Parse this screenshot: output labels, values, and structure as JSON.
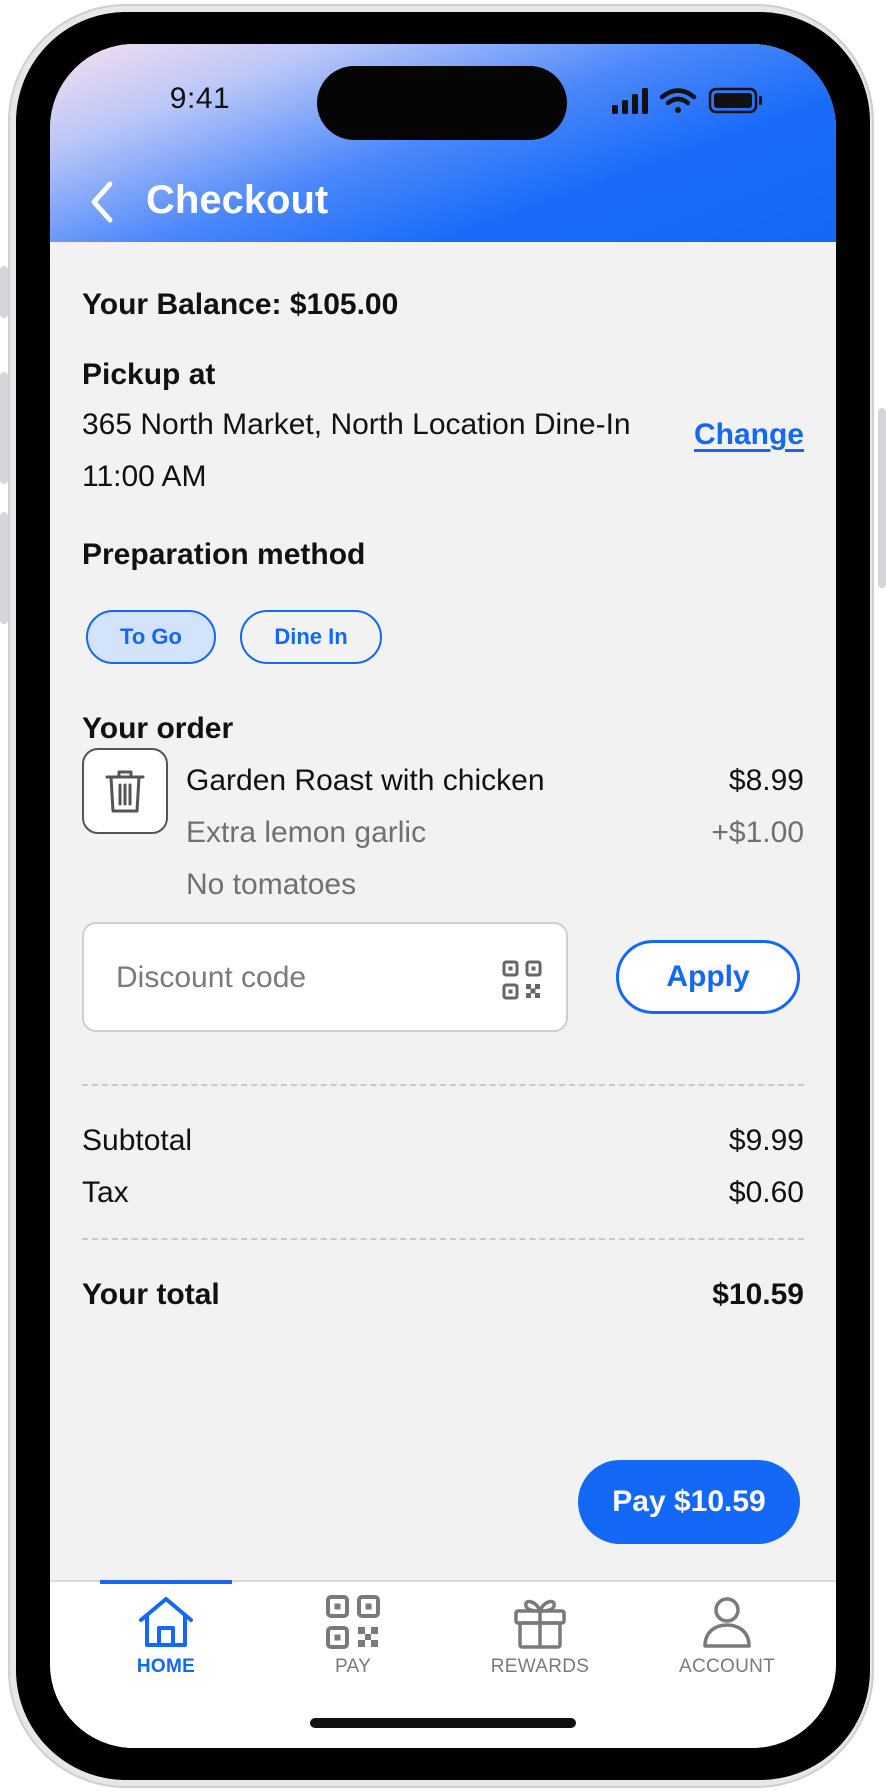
{
  "status_bar": {
    "time": "9:41"
  },
  "header": {
    "title": "Checkout"
  },
  "balance": {
    "text": "Your Balance: $105.00"
  },
  "pickup": {
    "heading": "Pickup at",
    "location": "365 North Market, North Location Dine-In",
    "time": "11:00 AM",
    "change_label": "Change"
  },
  "preparation": {
    "heading": "Preparation method",
    "options": [
      {
        "label": "To Go",
        "selected": true
      },
      {
        "label": "Dine In",
        "selected": false
      }
    ]
  },
  "order": {
    "heading": "Your order",
    "items": [
      {
        "name": "Garden Roast with chicken",
        "price": "$8.99",
        "modifiers": [
          {
            "text": "Extra lemon garlic",
            "price": "+$1.00"
          },
          {
            "text": "No tomatoes",
            "price": ""
          }
        ]
      }
    ]
  },
  "discount": {
    "placeholder": "Discount code",
    "value": "",
    "apply_label": "Apply"
  },
  "summary": {
    "subtotal_label": "Subtotal",
    "subtotal_value": "$9.99",
    "tax_label": "Tax",
    "tax_value": "$0.60",
    "total_label": "Your total",
    "total_value": "$10.59"
  },
  "pay_button": {
    "label": "Pay $10.59"
  },
  "tabbar": {
    "items": [
      {
        "label": "HOME",
        "icon": "home-icon",
        "active": true
      },
      {
        "label": "PAY",
        "icon": "qr-code-icon",
        "active": false
      },
      {
        "label": "REWARDS",
        "icon": "gift-icon",
        "active": false
      },
      {
        "label": "ACCOUNT",
        "icon": "person-icon",
        "active": false
      }
    ]
  },
  "colors": {
    "accent": "#1368F7",
    "background": "#F2F2F2",
    "selected_chip": "#D3E3FB",
    "muted_text": "#707070"
  }
}
